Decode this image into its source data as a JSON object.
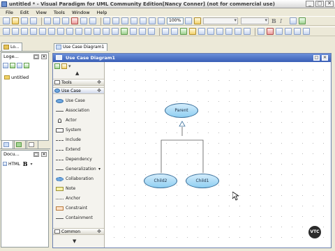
{
  "window": {
    "title": "untitled * - Visual Paradigm for UML Community Edition[Nancy Conner] (not for commercial use)",
    "controls": [
      "_",
      "□",
      "✕"
    ]
  },
  "menu": [
    "File",
    "Edit",
    "View",
    "Tools",
    "Window",
    "Help"
  ],
  "toolbar": {
    "zoom": "100%"
  },
  "left_top_panel": {
    "tab_label": "Lo...",
    "title": "Loge...",
    "tree_item": "untitled"
  },
  "left_bottom_panel": {
    "title": "Docu...",
    "format": "HTML",
    "bold": "B"
  },
  "diagram": {
    "tab_label": "Use Case Diagram1",
    "window_title": "Use Case Diagram1",
    "palette": {
      "group_tools": "Tools",
      "group_usecase": "Use Case",
      "group_common": "Common",
      "items": [
        "Use Case",
        "Association",
        "Actor",
        "System",
        "Include",
        "Extend",
        "Dependency",
        "Generalization",
        "Collaboration",
        "Note",
        "Anchor",
        "Constraint",
        "Containment"
      ]
    },
    "use_cases": {
      "parent": "Parent",
      "child2": "Child2",
      "child1": "Child1"
    }
  },
  "watermark": "VTC"
}
